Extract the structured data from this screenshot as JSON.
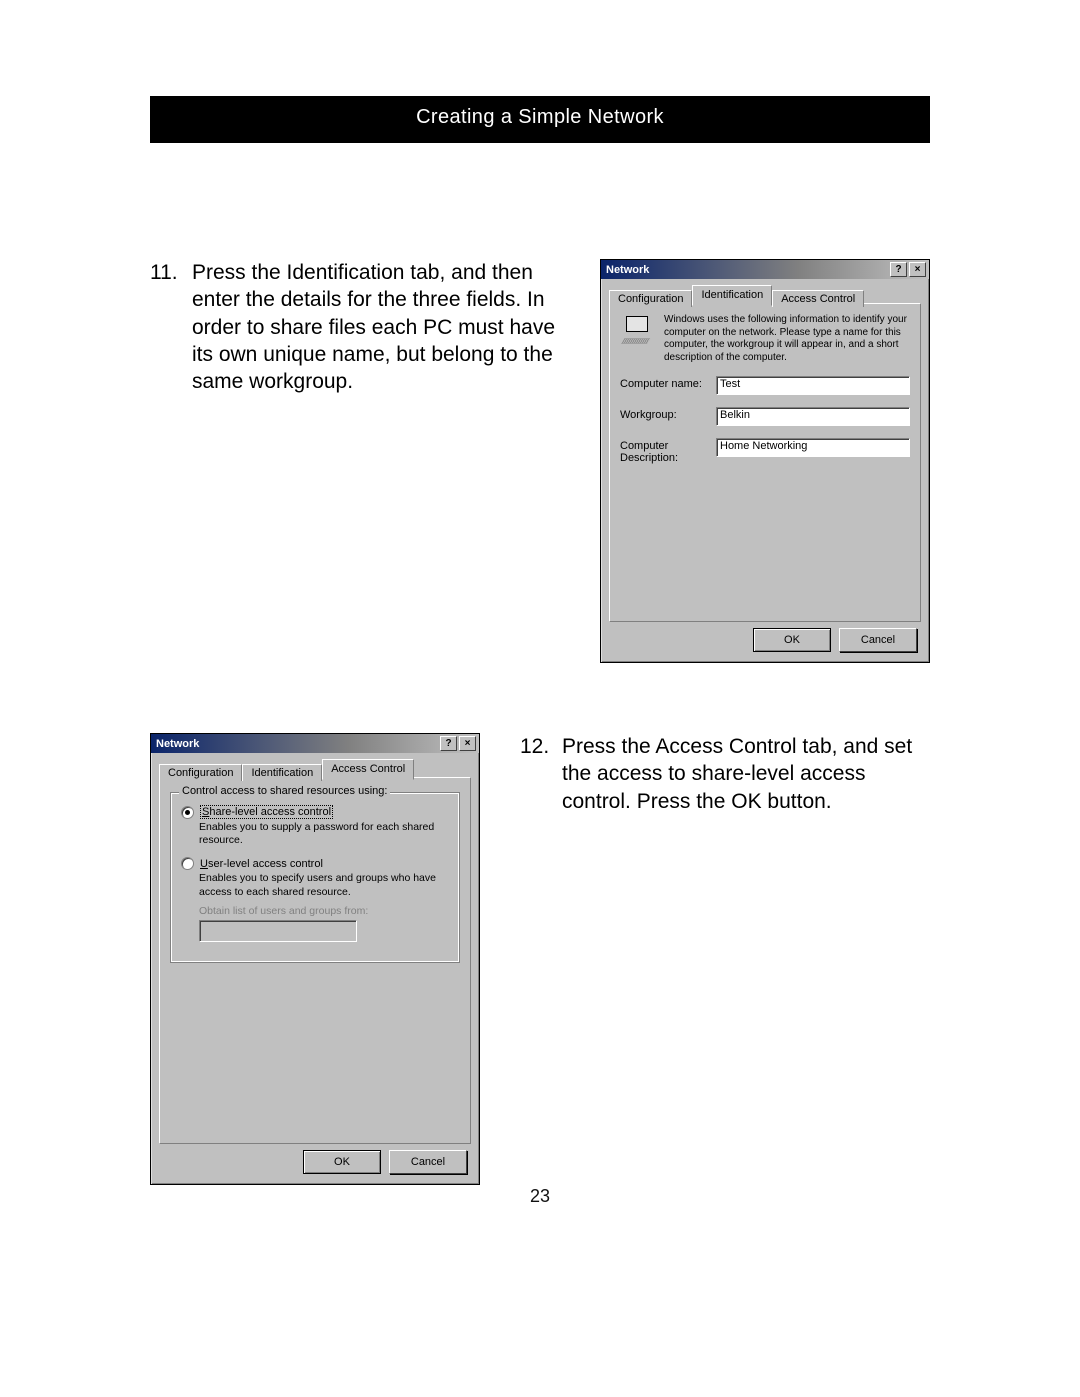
{
  "header": {
    "title": "Creating a Simple Network"
  },
  "step11": {
    "num": "11.",
    "body": "Press the Identification tab, and then enter the details for the three fields. In order to share files each PC must have its own unique name, but belong to the same workgroup."
  },
  "step12": {
    "num": "12.",
    "body": "Press the Access Control tab, and set the access to share-level access control. Press the OK button."
  },
  "dialog1": {
    "title": "Network",
    "help_glyph": "?",
    "close_glyph": "×",
    "tabs": {
      "config": "Configuration",
      "ident": "Identification",
      "access": "Access Control"
    },
    "info_text": "Windows uses the following information to identify your computer on the network.  Please type a name for this computer, the workgroup it will appear in, and a short description of the computer.",
    "fields": {
      "computer_name_label": "Computer name:",
      "computer_name_value": "Test",
      "workgroup_label": "Workgroup:",
      "workgroup_value": "Belkin",
      "description_label": "Computer Description:",
      "description_value": "Home Networking"
    },
    "buttons": {
      "ok": "OK",
      "cancel": "Cancel"
    }
  },
  "dialog2": {
    "title": "Network",
    "help_glyph": "?",
    "close_glyph": "×",
    "tabs": {
      "config": "Configuration",
      "ident": "Identification",
      "access": "Access Control"
    },
    "group_legend": "Control access to shared resources using:",
    "option1": {
      "label": "Share-level access control",
      "desc": "Enables you to supply a password for each shared resource."
    },
    "option2": {
      "label": "User-level access control",
      "desc": "Enables you to specify users and groups who have access to each shared resource.",
      "sub": "Obtain list of users and groups from:",
      "value": ""
    },
    "buttons": {
      "ok": "OK",
      "cancel": "Cancel"
    }
  },
  "page_number": "23"
}
